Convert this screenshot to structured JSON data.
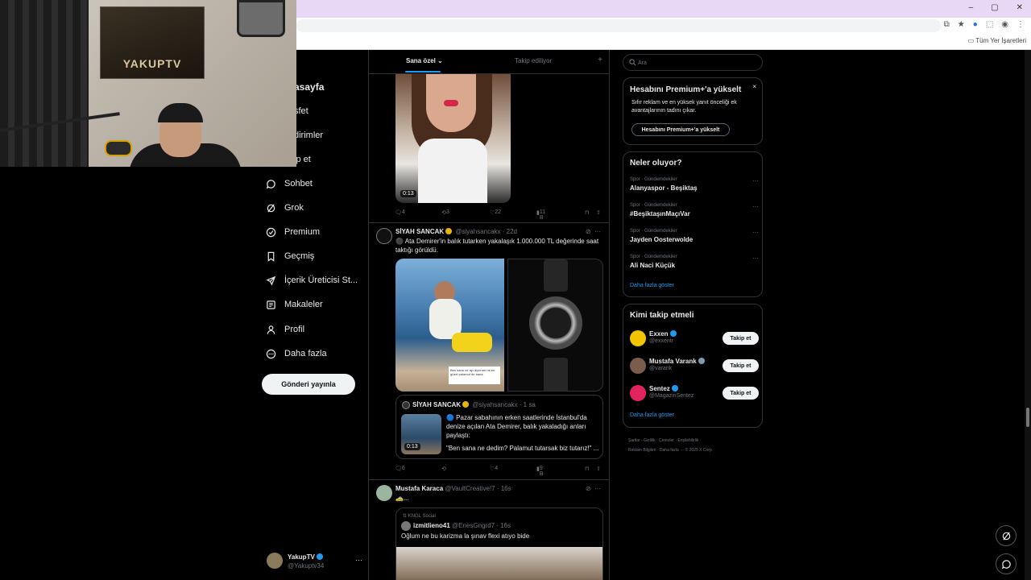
{
  "browser": {
    "bookmarks_label": "Tüm Yer İşaretleri",
    "controls": [
      "–",
      "▢",
      "✕"
    ]
  },
  "webcam": {
    "poster_text": "YAKUPTV"
  },
  "sidebar": {
    "partial_items": [
      {
        "label": "asayfa"
      },
      {
        "label": "sfet"
      },
      {
        "label": "dirimler"
      },
      {
        "label": "ip et"
      }
    ],
    "items": [
      {
        "label": "Sohbet",
        "icon": "chat-icon"
      },
      {
        "label": "Grok",
        "icon": "grok-icon"
      },
      {
        "label": "Premium",
        "icon": "premium-icon"
      },
      {
        "label": "Geçmiş",
        "icon": "bookmark-icon"
      },
      {
        "label": "İçerik Üreticisi St...",
        "icon": "rocket-icon"
      },
      {
        "label": "Makaleler",
        "icon": "articles-icon"
      },
      {
        "label": "Profil",
        "icon": "profile-icon"
      },
      {
        "label": "Daha fazla",
        "icon": "more-icon"
      }
    ],
    "post_button": "Gönderi yayınla",
    "account": {
      "name": "YakupTV",
      "handle": "@Yakuptv34",
      "more": "···"
    }
  },
  "timeline": {
    "tabs": [
      {
        "label": "Sana özel ⌄",
        "active": true
      },
      {
        "label": "Takip ediliyor",
        "active": false
      }
    ],
    "new_tab": "+",
    "post1": {
      "duration": "0:13",
      "actions": {
        "replies": "4",
        "reposts": "3",
        "likes": "22",
        "views": "11 B"
      }
    },
    "post2": {
      "author": "SİYAH SANCAK",
      "handle": "@siyahsancakx · 22d",
      "text": "⚫ Ata Demirer'in balık tutarken yakalaşık 1.000.000 TL değerinde saat taktığı görüldü.",
      "image_caption": "Ben sana ne ayı diyorum ne en güzel palamut de bana.",
      "quote": {
        "author": "SİYAH SANCAK",
        "handle": "@siyahsancakx · 1 sa",
        "duration": "0:13",
        "text": "🔵 Pazar sabahının erken saatlerinde İstanbul'da denize açılan Ata Demirer, balık yakaladığı anları paylaştı:",
        "text2": "\"Ben sana ne dedim? Palamut tutarsak biz tutarız!\" ..."
      },
      "actions": {
        "replies": "6",
        "reposts": "",
        "likes": "4",
        "views": "9 B"
      }
    },
    "post3": {
      "author": "Mustafa Karaca",
      "handle": "@VaultCreative!7 · 16s",
      "text": "🚕...",
      "retweet": {
        "social": "KNGL Social",
        "author": "izmitlieno41",
        "handle": "@EnesGngrd7 · 16s",
        "text": "Oğlum ne bu karizma la şınav flexi atıyo bide"
      }
    }
  },
  "right": {
    "search_placeholder": "Ara",
    "premium": {
      "title": "Hesabını Premium+'a yükselt",
      "close": "×",
      "desc": "Sıfır reklam ve en yüksek yanıt önceliği ek avantajlarının tadını çıkar.",
      "button": "Hesabını Premium+'a yükselt"
    },
    "trends": {
      "title": "Neler oluyor?",
      "items": [
        {
          "category": "Spor · Gündemdekiler",
          "name": "Alanyaspor - Beşiktaş"
        },
        {
          "category": "Spor · Gündemdekiler",
          "name": "#BeşiktaşınMaçıVar"
        },
        {
          "category": "Spor · Gündemdekiler",
          "name": "Jayden Oosterwolde"
        },
        {
          "category": "Spor · Gündemdekiler",
          "name": "Ali Naci Küçük"
        }
      ],
      "more_dots": "···",
      "show_more": "Daha fazla göster"
    },
    "who_to_follow": {
      "title": "Kimi takip etmeli",
      "items": [
        {
          "name": "Exxen",
          "handle": "@exxentr",
          "badge_color": "#1d9bf0",
          "avatar_color": "#f5c400"
        },
        {
          "name": "Mustafa Varank",
          "handle": "@varank",
          "badge_color": "#829aab",
          "avatar_color": "#7a5d4d"
        },
        {
          "name": "Sentez",
          "handle": "@MagazinSentez",
          "badge_color": "#1d9bf0",
          "avatar_color": "#e0245e"
        }
      ],
      "follow_label": "Takip et",
      "show_more": "Daha fazla göster"
    },
    "footer": {
      "line1": "Şartlar · Gizlilik · Çerezler · Erişilebilirlik ·",
      "line2": "Reklam Bilgileri · Daha fazla ··· © 2025 X Corp."
    }
  },
  "colors": {
    "accent": "#1d9bf0",
    "background": "#000000",
    "border": "#2f3336",
    "muted_text": "#71767b",
    "gold_badge": "#e8b400"
  }
}
